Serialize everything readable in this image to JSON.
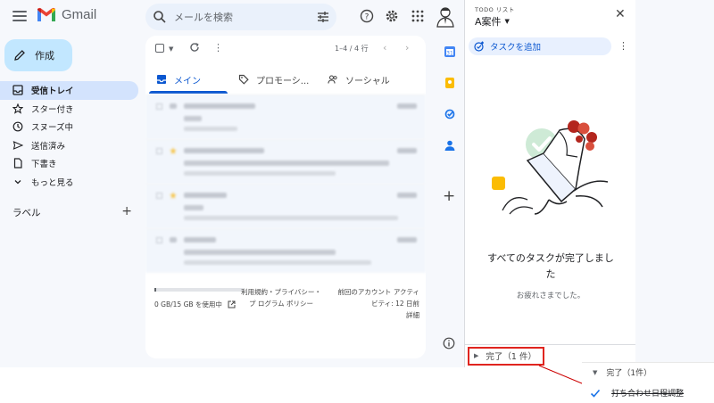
{
  "app": {
    "logo_text": "Gmail"
  },
  "search": {
    "placeholder": "メールを検索"
  },
  "compose": {
    "label": "作成"
  },
  "sidebar": {
    "items": [
      {
        "label": "受信トレイ",
        "icon": "inbox-icon",
        "active": true
      },
      {
        "label": "スター付き",
        "icon": "star-icon"
      },
      {
        "label": "スヌーズ中",
        "icon": "clock-icon"
      },
      {
        "label": "送信済み",
        "icon": "send-icon"
      },
      {
        "label": "下書き",
        "icon": "draft-icon"
      },
      {
        "label": "もっと見る",
        "icon": "chevron-down-icon"
      }
    ],
    "labels_heading": "ラベル",
    "add_label": "+"
  },
  "toolbar": {
    "range": "1–4 / 4 行"
  },
  "tabs": [
    {
      "label": "メイン",
      "icon": "inbox-icon",
      "active": true
    },
    {
      "label": "プロモーシ...",
      "icon": "tag-icon"
    },
    {
      "label": "ソーシャル",
      "icon": "people-icon"
    }
  ],
  "footer": {
    "storage": "0 GB/15 GB を使用中",
    "storage_used_fraction": 0.02,
    "policy": "利用規約・プライバシー・プ ログラム ポリシー",
    "activity": "前回のアカウント アクティ ビティ: 12 日前",
    "details": "詳細"
  },
  "tasks": {
    "eyebrow": "TODO リスト",
    "list_name": "A案件",
    "add_task": "タスクを追加",
    "empty_title": "すべてのタスクが完了しました",
    "empty_sub": "お疲れさまでした。",
    "completed_label": "完了（1 件）"
  },
  "callout": {
    "header": "完了（1件）",
    "task": "打ち合わせ日程調整"
  },
  "colors": {
    "accent": "#0b57d0",
    "compose": "#c2e7ff",
    "highlight": "#e0251f"
  }
}
